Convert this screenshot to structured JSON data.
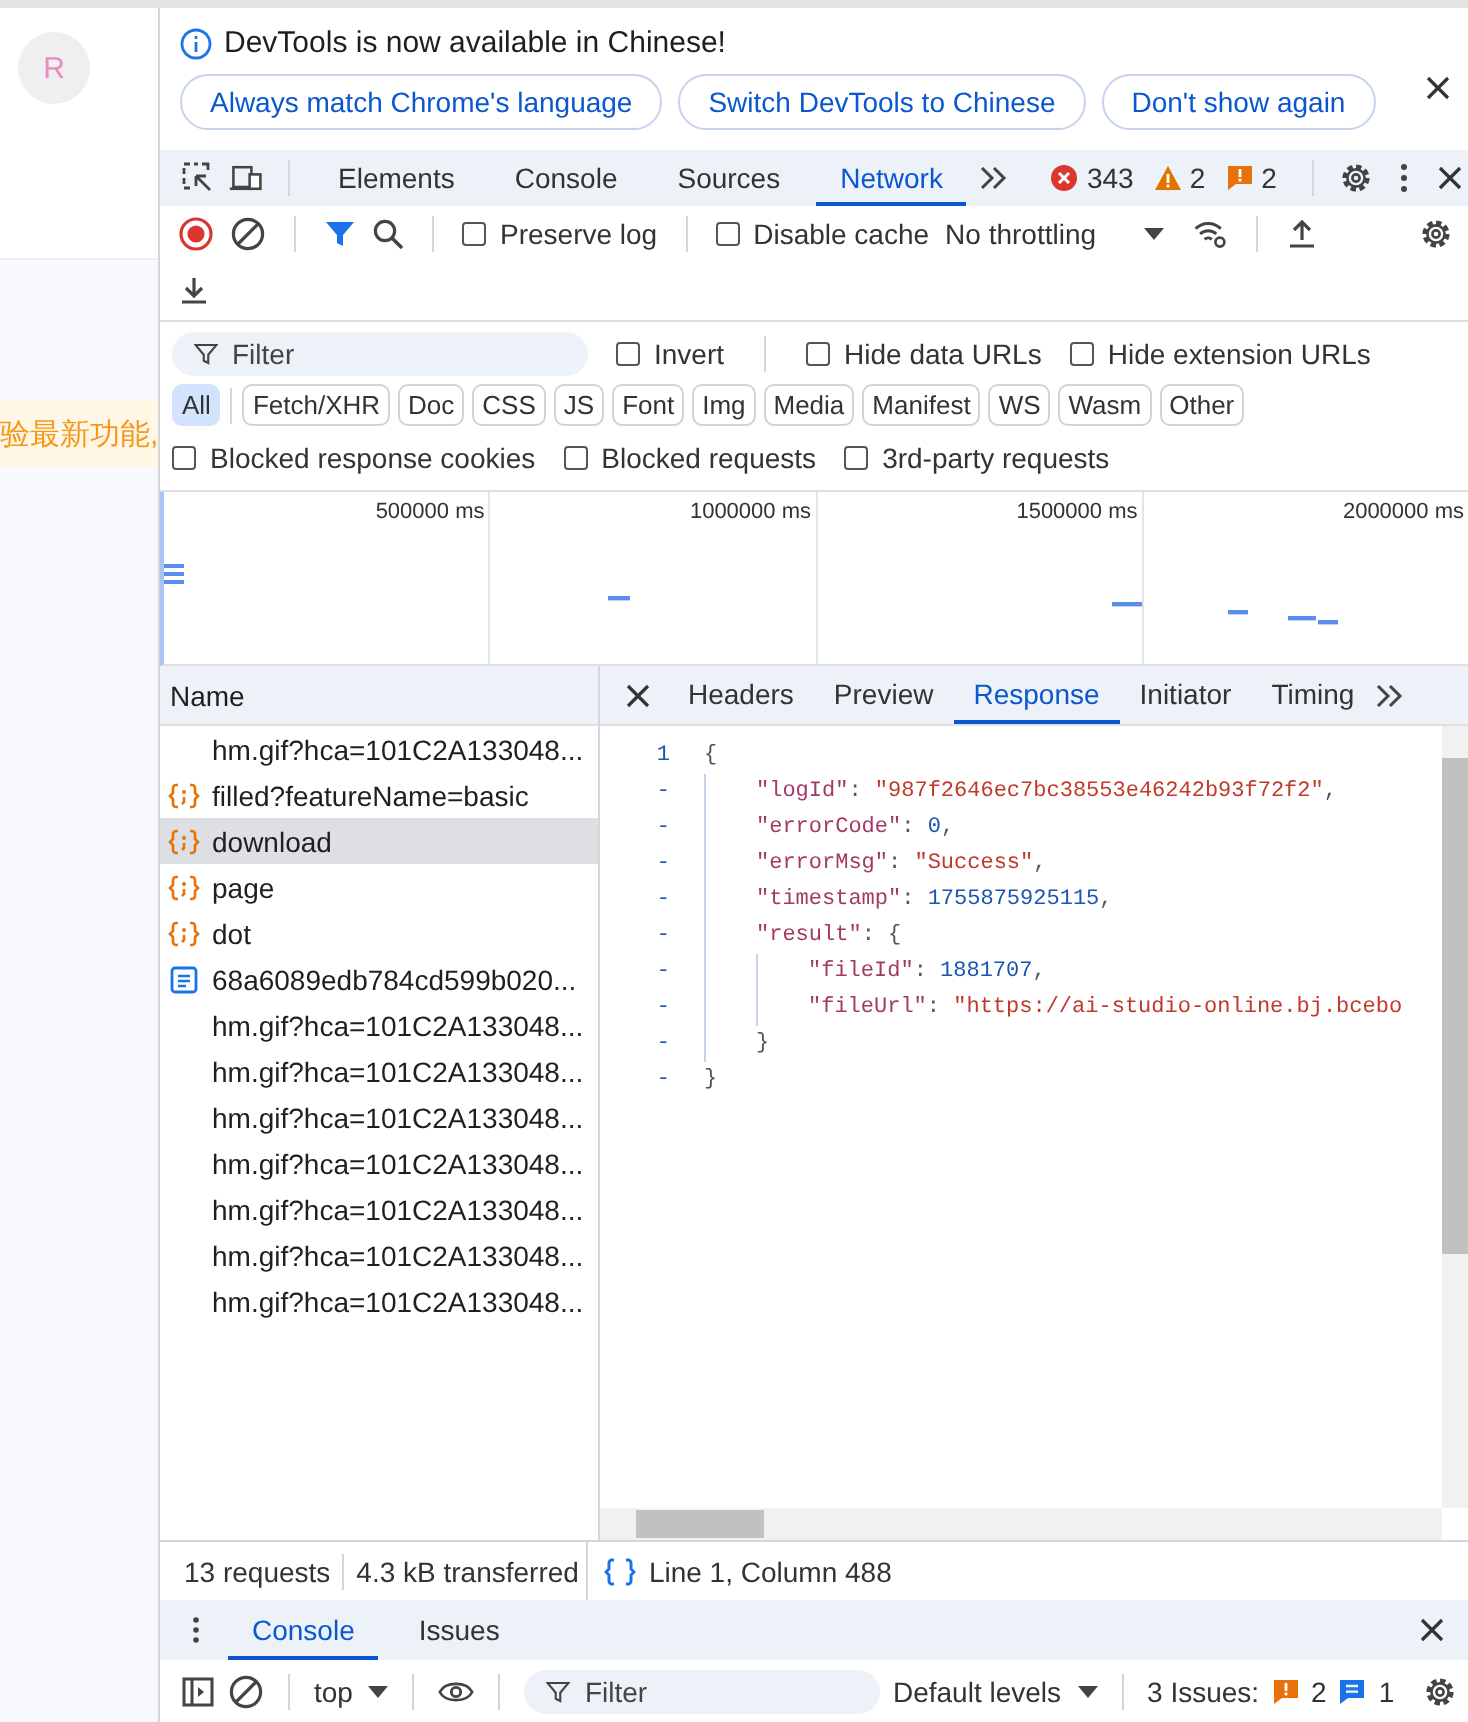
{
  "page": {
    "avatar_letter": "R",
    "banner_text": "验最新功能,"
  },
  "infobar": {
    "message": "DevTools is now available in Chinese!",
    "buttons": [
      "Always match Chrome's language",
      "Switch DevTools to Chinese",
      "Don't show again"
    ]
  },
  "main_tabs": [
    {
      "label": "Elements",
      "selected": false
    },
    {
      "label": "Console",
      "selected": false
    },
    {
      "label": "Sources",
      "selected": false
    },
    {
      "label": "Network",
      "selected": true
    }
  ],
  "counters": {
    "errors": "343",
    "warnings": "2",
    "issues": "2"
  },
  "toolbar": {
    "recording": true,
    "checkboxes": [
      {
        "label": "Preserve log",
        "checked": false
      },
      {
        "label": "Disable cache",
        "checked": false
      }
    ],
    "throttling": "No throttling"
  },
  "filter": {
    "placeholder": "Filter",
    "checkboxes": [
      {
        "label": "Invert",
        "checked": false
      },
      {
        "label": "Hide data URLs",
        "checked": false
      },
      {
        "label": "Hide extension URLs",
        "checked": false
      }
    ]
  },
  "type_filters": [
    {
      "label": "All",
      "selected": true
    },
    {
      "label": "Fetch/XHR",
      "selected": false
    },
    {
      "label": "Doc",
      "selected": false
    },
    {
      "label": "CSS",
      "selected": false
    },
    {
      "label": "JS",
      "selected": false
    },
    {
      "label": "Font",
      "selected": false
    },
    {
      "label": "Img",
      "selected": false
    },
    {
      "label": "Media",
      "selected": false
    },
    {
      "label": "Manifest",
      "selected": false
    },
    {
      "label": "WS",
      "selected": false
    },
    {
      "label": "Wasm",
      "selected": false
    },
    {
      "label": "Other",
      "selected": false
    }
  ],
  "extra_checkboxes": [
    {
      "label": "Blocked response cookies",
      "checked": false
    },
    {
      "label": "Blocked requests",
      "checked": false
    },
    {
      "label": "3rd-party requests",
      "checked": false
    }
  ],
  "overview": {
    "ticks": [
      "500000 ms",
      "1000000 ms",
      "1500000 ms",
      "2000000 ms"
    ]
  },
  "requests": {
    "column": "Name",
    "rows": [
      {
        "name": "hm.gif?hca=101C2A133048...",
        "kind": "plain",
        "selected": false
      },
      {
        "name": "filled?featureName=basic",
        "kind": "fetch",
        "selected": false
      },
      {
        "name": "download",
        "kind": "fetch",
        "selected": true
      },
      {
        "name": "page",
        "kind": "fetch",
        "selected": false
      },
      {
        "name": "dot",
        "kind": "fetch",
        "selected": false
      },
      {
        "name": "68a6089edb784cd599b020...",
        "kind": "document",
        "selected": false
      },
      {
        "name": "hm.gif?hca=101C2A133048...",
        "kind": "plain",
        "selected": false
      },
      {
        "name": "hm.gif?hca=101C2A133048...",
        "kind": "plain",
        "selected": false
      },
      {
        "name": "hm.gif?hca=101C2A133048...",
        "kind": "plain",
        "selected": false
      },
      {
        "name": "hm.gif?hca=101C2A133048...",
        "kind": "plain",
        "selected": false
      },
      {
        "name": "hm.gif?hca=101C2A133048...",
        "kind": "plain",
        "selected": false
      },
      {
        "name": "hm.gif?hca=101C2A133048...",
        "kind": "plain",
        "selected": false
      },
      {
        "name": "hm.gif?hca=101C2A133048...",
        "kind": "plain",
        "selected": false
      }
    ]
  },
  "detail_tabs": [
    {
      "label": "Headers",
      "selected": false
    },
    {
      "label": "Preview",
      "selected": false
    },
    {
      "label": "Response",
      "selected": true
    },
    {
      "label": "Initiator",
      "selected": false
    },
    {
      "label": "Timing",
      "selected": false
    }
  ],
  "response": {
    "lines": [
      {
        "gutter": "1",
        "tokens": [
          {
            "kind": "punct",
            "text": "{"
          }
        ],
        "children": [
          {
            "gutter": "-",
            "tokens": [
              {
                "kind": "key",
                "text": "\"logId\""
              },
              {
                "kind": "punct",
                "text": ": "
              },
              {
                "kind": "string",
                "text": "\"987f2646ec7bc38553e46242b93f72f2\""
              },
              {
                "kind": "punct",
                "text": ","
              }
            ]
          },
          {
            "gutter": "-",
            "tokens": [
              {
                "kind": "key",
                "text": "\"errorCode\""
              },
              {
                "kind": "punct",
                "text": ": "
              },
              {
                "kind": "number",
                "text": "0"
              },
              {
                "kind": "punct",
                "text": ","
              }
            ]
          },
          {
            "gutter": "-",
            "tokens": [
              {
                "kind": "key",
                "text": "\"errorMsg\""
              },
              {
                "kind": "punct",
                "text": ": "
              },
              {
                "kind": "string",
                "text": "\"Success\""
              },
              {
                "kind": "punct",
                "text": ","
              }
            ]
          },
          {
            "gutter": "-",
            "tokens": [
              {
                "kind": "key",
                "text": "\"timestamp\""
              },
              {
                "kind": "punct",
                "text": ": "
              },
              {
                "kind": "number",
                "text": "1755875925115"
              },
              {
                "kind": "punct",
                "text": ","
              }
            ]
          },
          {
            "gutter": "-",
            "tokens": [
              {
                "kind": "key",
                "text": "\"result\""
              },
              {
                "kind": "punct",
                "text": ": {"
              }
            ],
            "children": [
              {
                "gutter": "-",
                "tokens": [
                  {
                    "kind": "key",
                    "text": "\"fileId\""
                  },
                  {
                    "kind": "punct",
                    "text": ": "
                  },
                  {
                    "kind": "number",
                    "text": "1881707"
                  },
                  {
                    "kind": "punct",
                    "text": ","
                  }
                ]
              },
              {
                "gutter": "-",
                "tokens": [
                  {
                    "kind": "key",
                    "text": "\"fileUrl\""
                  },
                  {
                    "kind": "punct",
                    "text": ": "
                  },
                  {
                    "kind": "string",
                    "text": "\"https://ai-studio-online.bj.bcebo"
                  }
                ]
              }
            ]
          },
          {
            "gutter": "-",
            "tokens": [
              {
                "kind": "punct",
                "text": "}"
              }
            ]
          }
        ]
      },
      {
        "gutter": "-",
        "tokens": [
          {
            "kind": "punct",
            "text": "}"
          }
        ]
      }
    ]
  },
  "status": {
    "requests": "13 requests",
    "transferred": "4.3 kB transferred",
    "position": "Line 1, Column 488"
  },
  "drawer": {
    "tabs": [
      {
        "label": "Console",
        "selected": true
      },
      {
        "label": "Issues",
        "selected": false
      }
    ],
    "context": "top",
    "filter_placeholder": "Filter",
    "levels": "Default levels",
    "issues_label": "3 Issues:",
    "issue_warnings": "2",
    "issue_info": "1"
  }
}
